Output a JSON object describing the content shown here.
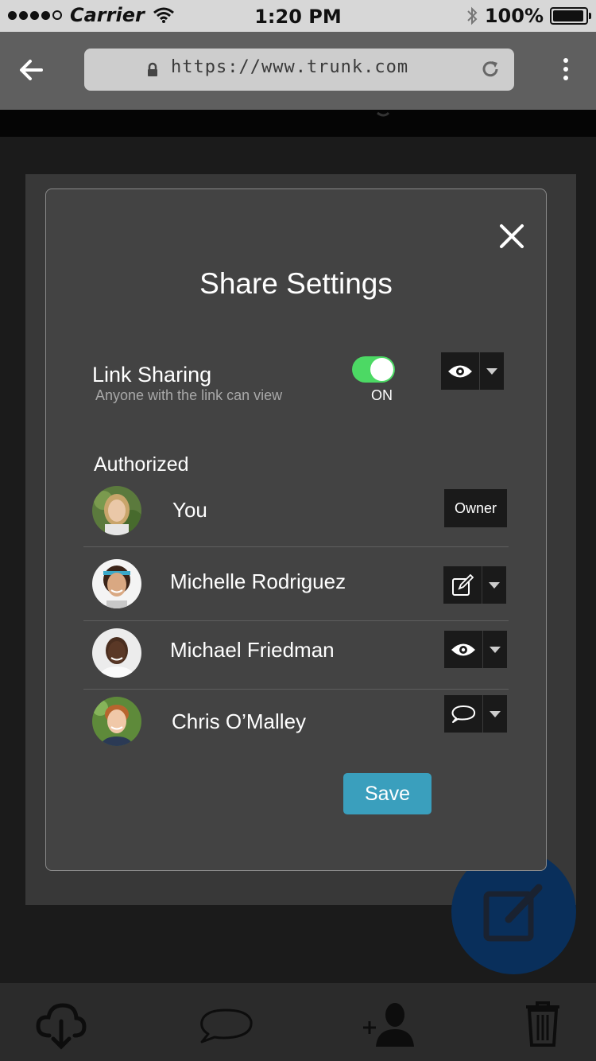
{
  "status_bar": {
    "carrier": "Carrier",
    "time": "1:20 PM",
    "battery": "100%"
  },
  "browser": {
    "url": "https://www.trunk.com"
  },
  "modal": {
    "title": "Share Settings",
    "link_sharing": {
      "label": "Link Sharing",
      "description": "Anyone with the link can view",
      "toggle_state": "ON",
      "permission_icon": "eye-icon"
    },
    "authorized_heading": "Authorized",
    "users": [
      {
        "name": "You",
        "role": "Owner"
      },
      {
        "name": "Michelle Rodriguez",
        "permission_icon": "edit-icon"
      },
      {
        "name": "Michael Friedman",
        "permission_icon": "eye-icon"
      },
      {
        "name": "Chris O’Malley",
        "permission_icon": "comment-icon"
      }
    ],
    "save_label": "Save"
  },
  "colors": {
    "toggle_on": "#4cd964",
    "save_button": "#3a9fbd",
    "fab": "#092f5b"
  }
}
